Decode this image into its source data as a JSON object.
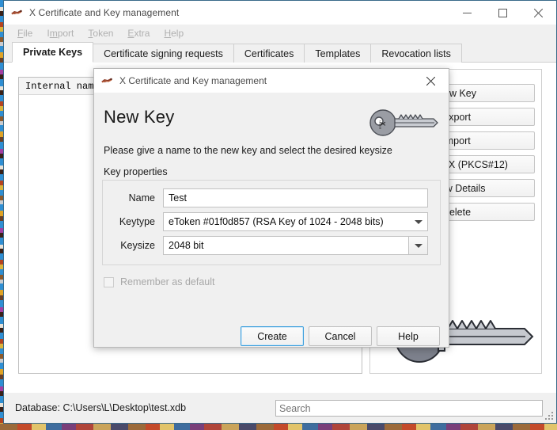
{
  "window": {
    "title": "X Certificate and Key management",
    "icon": "app-xca-icon",
    "controls": {
      "minimize": "minimize-icon",
      "maximize": "maximize-icon",
      "close": "close-icon"
    }
  },
  "menubar": {
    "items": [
      {
        "label": "File",
        "mnemonic": "F"
      },
      {
        "label": "Import",
        "mnemonic": "m"
      },
      {
        "label": "Token",
        "mnemonic": "T"
      },
      {
        "label": "Extra",
        "mnemonic": "E"
      },
      {
        "label": "Help",
        "mnemonic": "H"
      }
    ]
  },
  "tabs": [
    {
      "label": "Private Keys",
      "active": true
    },
    {
      "label": "Certificate signing requests",
      "active": false
    },
    {
      "label": "Certificates",
      "active": false
    },
    {
      "label": "Templates",
      "active": false
    },
    {
      "label": "Revocation lists",
      "active": false
    }
  ],
  "list": {
    "columns": [
      "Internal name"
    ],
    "rows": []
  },
  "side_buttons": [
    {
      "label": "New Key"
    },
    {
      "label": "Export"
    },
    {
      "label": "Import"
    },
    {
      "label": "Import PFX (PKCS#12)"
    },
    {
      "label": "Show Details"
    },
    {
      "label": "Delete"
    }
  ],
  "statusbar": {
    "database_label": "Database: C:\\Users\\L\\Desktop\\test.xdb",
    "search_placeholder": "Search",
    "search_value": "",
    "resize_grip": "resize-grip-icon"
  },
  "dialog": {
    "title": "X Certificate and Key management",
    "icon": "app-xca-icon",
    "close_icon": "close-icon",
    "heading": "New Key",
    "heading_icon": "key-icon",
    "subtitle": "Please give a name to the new key and select the desired keysize",
    "group_label": "Key properties",
    "fields": {
      "name": {
        "label": "Name",
        "value": "Test",
        "placeholder": ""
      },
      "keytype": {
        "label": "Keytype",
        "value": "eToken #01f0d857 (RSA Key of 1024 - 2048 bits)",
        "arrow_icon": "chevron-down-icon"
      },
      "keysize": {
        "label": "Keysize",
        "value": "2048 bit",
        "arrow_icon": "chevron-down-icon"
      }
    },
    "remember": {
      "label": "Remember as default",
      "checked": false,
      "enabled": false
    },
    "buttons": [
      {
        "label": "Create",
        "default": true
      },
      {
        "label": "Cancel",
        "default": false
      },
      {
        "label": "Help",
        "default": false
      }
    ]
  },
  "colors": {
    "window_border": "#3a6b8a",
    "dialog_bg": "#f0f0f0",
    "default_button_focus": "#3fa0dd",
    "titlebar_text": "#4a4a4a",
    "disabled_text": "#b0b0b0"
  }
}
